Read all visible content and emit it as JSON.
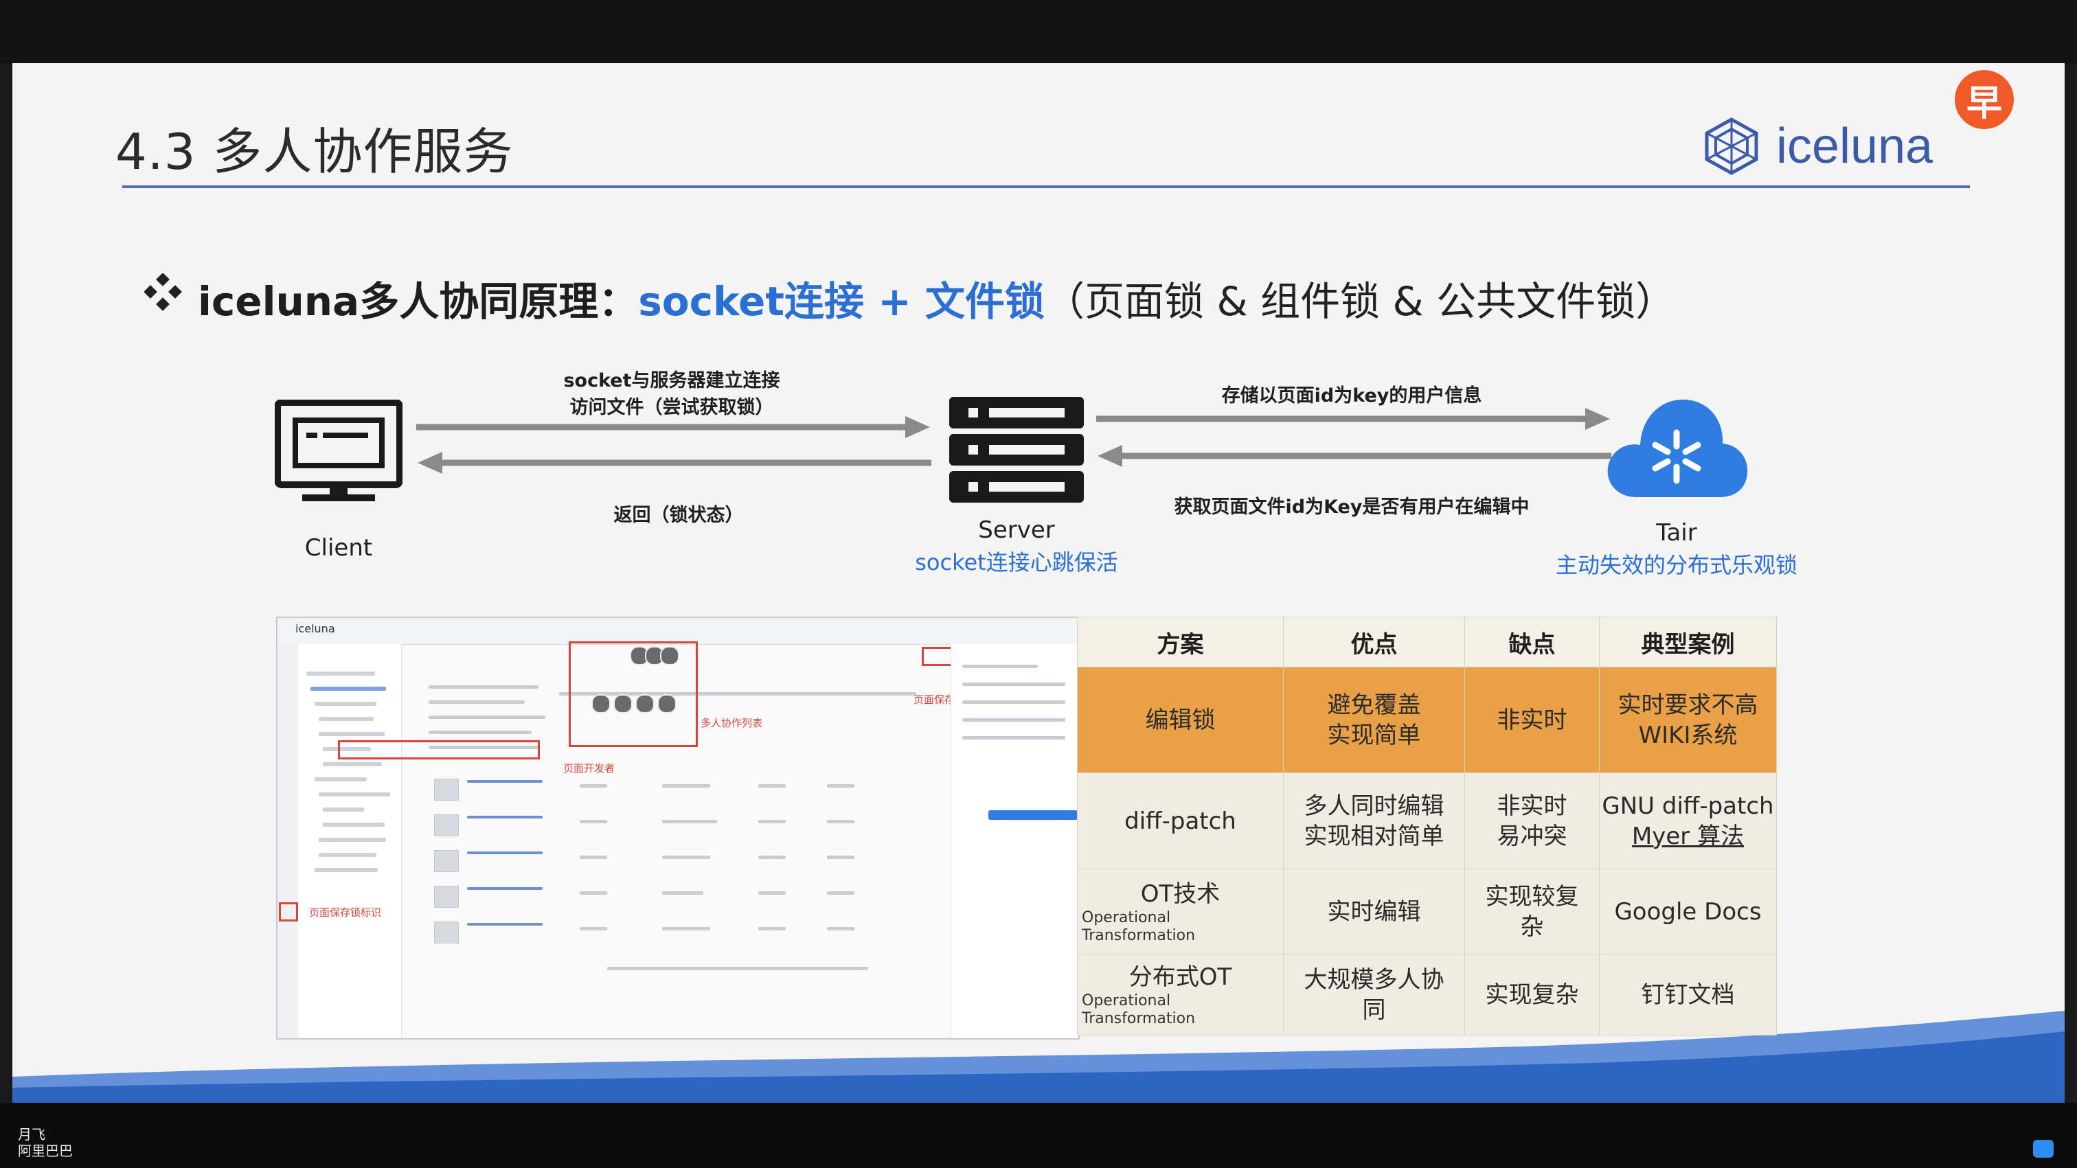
{
  "slide": {
    "title": "4.3 多人协作服务",
    "logo_text": "iceluna",
    "badge_text": "早",
    "headline": {
      "lead": "iceluna多人协同原理：",
      "highlight": "socket连接 + 文件锁",
      "trail": "（页面锁 & 组件锁 & 公共文件锁）"
    }
  },
  "diagram": {
    "client_label": "Client",
    "server_label": "Server",
    "server_sub": "socket连接心跳保活",
    "tair_label": "Tair",
    "tair_sub": "主动失效的分布式乐观锁",
    "arrow_client_server_line1": "socket与服务器建立连接",
    "arrow_client_server_line2": "访问文件（尝试获取锁）",
    "arrow_server_client": "返回（锁状态）",
    "arrow_server_tair": "存储以页面id为key的用户信息",
    "arrow_tair_server": "获取页面文件id为Key是否有用户在编辑中"
  },
  "screenshot": {
    "brand": "iceluna",
    "label_collab_list": "多人协作列表",
    "label_page_developer": "页面开发者",
    "label_page_save_lock": "页面保存锁",
    "label_save_lock_mark": "页面保存锁标识"
  },
  "table": {
    "headers": [
      "方案",
      "优点",
      "缺点",
      "典型案例"
    ],
    "rows": [
      {
        "scheme": "编辑锁",
        "scheme_en": "",
        "pros": [
          "避免覆盖",
          "实现简单"
        ],
        "cons": [
          "非实时"
        ],
        "cases": [
          "实时要求不高",
          "WIKI系统"
        ]
      },
      {
        "scheme": "diff-patch",
        "scheme_en": "",
        "pros": [
          "多人同时编辑",
          "实现相对简单"
        ],
        "cons": [
          "非实时",
          "易冲突"
        ],
        "cases": [
          "GNU diff-patch",
          "Myer 算法"
        ]
      },
      {
        "scheme": "OT技术",
        "scheme_en": "Operational Transformation",
        "pros": [
          "实时编辑"
        ],
        "cons": [
          "实现较复",
          "杂"
        ],
        "cases": [
          "Google Docs"
        ]
      },
      {
        "scheme": "分布式OT",
        "scheme_en": "Operational Transformation",
        "pros": [
          "大规模多人协",
          "同"
        ],
        "cons": [
          "实现复杂"
        ],
        "cases": [
          "钉钉文档"
        ]
      }
    ]
  },
  "footer": {
    "speaker_name": "月飞",
    "speaker_org": "阿里巴巴"
  },
  "colors": {
    "accent_blue": "#2c6fd4",
    "highlight_orange": "#e9a046",
    "badge_orange": "#f05a28",
    "tair_blue": "#2f7de1"
  }
}
